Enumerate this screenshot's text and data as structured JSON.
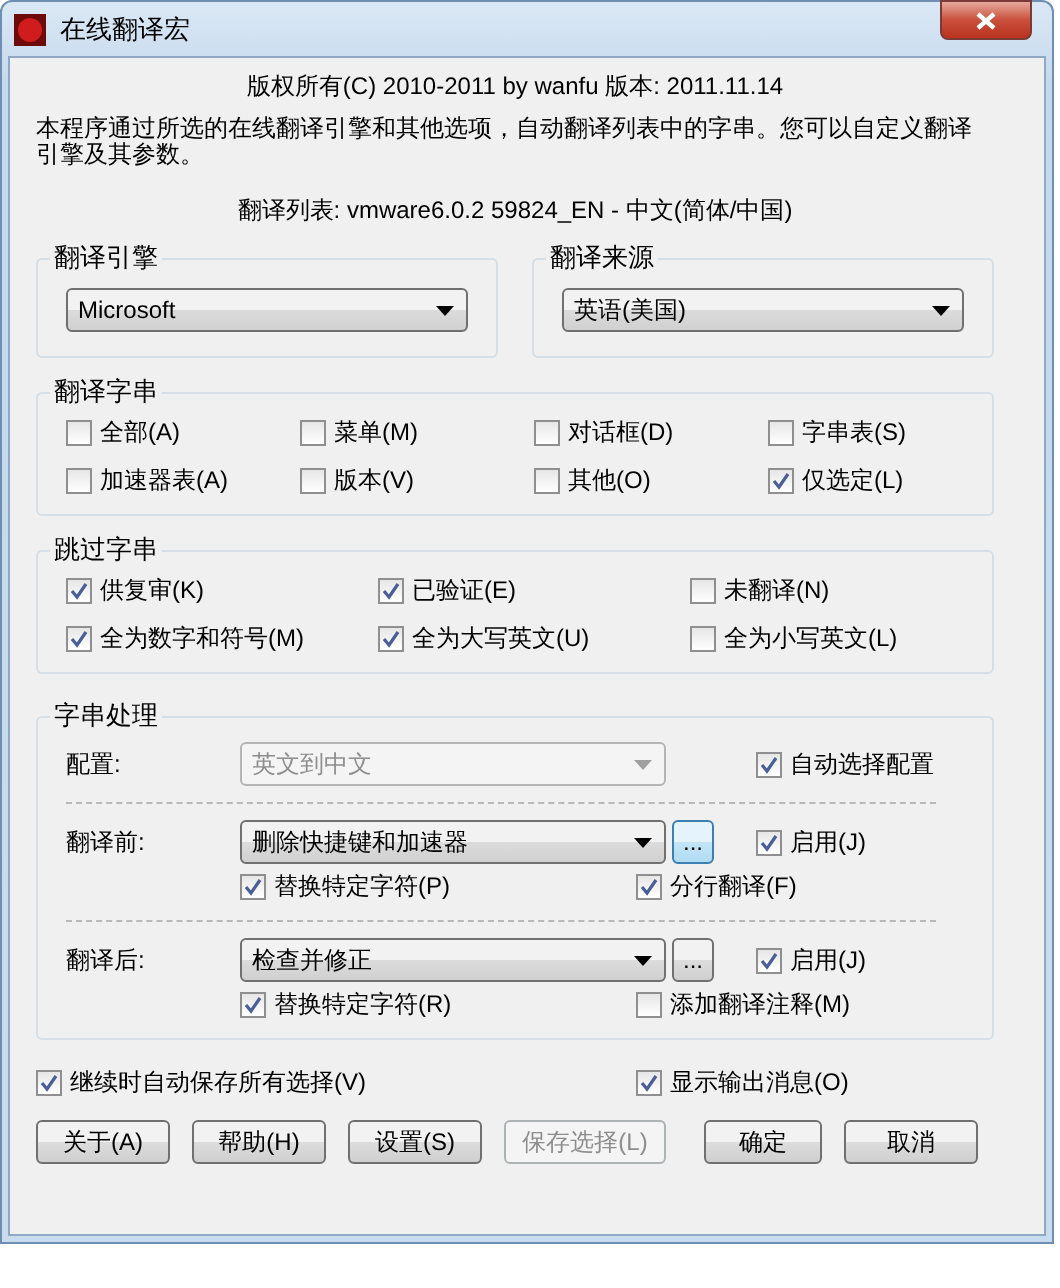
{
  "window": {
    "title": "在线翻译宏"
  },
  "header": {
    "copyright": "版权所有(C) 2010-2011 by wanfu  版本: 2011.11.14",
    "description": "本程序通过所选的在线翻译引擎和其他选项，自动翻译列表中的字串。您可以自定义翻译引擎及其参数。",
    "list_info": "翻译列表: vmware6.0.2 59824_EN - 中文(简体/中国)"
  },
  "engine": {
    "label": "翻译引擎",
    "value": "Microsoft"
  },
  "source": {
    "label": "翻译来源",
    "value": "英语(美国)"
  },
  "translate_strings": {
    "label": "翻译字串",
    "options": [
      {
        "label": "全部(A)",
        "checked": false
      },
      {
        "label": "菜单(M)",
        "checked": false
      },
      {
        "label": "对话框(D)",
        "checked": false
      },
      {
        "label": "字串表(S)",
        "checked": false
      },
      {
        "label": "加速器表(A)",
        "checked": false
      },
      {
        "label": "版本(V)",
        "checked": false
      },
      {
        "label": "其他(O)",
        "checked": false
      },
      {
        "label": "仅选定(L)",
        "checked": true
      }
    ]
  },
  "skip_strings": {
    "label": "跳过字串",
    "options": [
      {
        "label": "供复审(K)",
        "checked": true
      },
      {
        "label": "已验证(E)",
        "checked": true
      },
      {
        "label": "未翻译(N)",
        "checked": false
      },
      {
        "label": "全为数字和符号(M)",
        "checked": true
      },
      {
        "label": "全为大写英文(U)",
        "checked": true
      },
      {
        "label": "全为小写英文(L)",
        "checked": false
      }
    ]
  },
  "processing": {
    "label": "字串处理",
    "config": {
      "label": "配置:",
      "value": "英文到中文",
      "disabled": true
    },
    "auto_config": {
      "label": "自动选择配置",
      "checked": true
    },
    "steps": [
      {
        "label": "翻译前:",
        "value": "删除快捷键和加速器",
        "more": "...",
        "more_focused": true,
        "enable": {
          "label": "启用(J)",
          "checked": true
        },
        "options": [
          {
            "label": "替换特定字符(P)",
            "checked": true
          },
          {
            "label": "分行翻译(F)",
            "checked": true
          }
        ]
      },
      {
        "label": "翻译后:",
        "value": "检查并修正",
        "more": "...",
        "more_focused": false,
        "enable": {
          "label": "启用(J)",
          "checked": true
        },
        "options": [
          {
            "label": "替换特定字符(R)",
            "checked": true
          },
          {
            "label": "添加翻译注释(M)",
            "checked": false
          }
        ]
      }
    ]
  },
  "footer_options": [
    {
      "label": "继续时自动保存所有选择(V)",
      "checked": true
    },
    {
      "label": "显示输出消息(O)",
      "checked": true
    }
  ],
  "buttons": [
    {
      "label": "关于(A)",
      "disabled": false
    },
    {
      "label": "帮助(H)",
      "disabled": false
    },
    {
      "label": "设置(S)",
      "disabled": false
    },
    {
      "label": "保存选择(L)",
      "disabled": true
    },
    {
      "label": "确定",
      "disabled": false
    },
    {
      "label": "取消",
      "disabled": false
    }
  ]
}
